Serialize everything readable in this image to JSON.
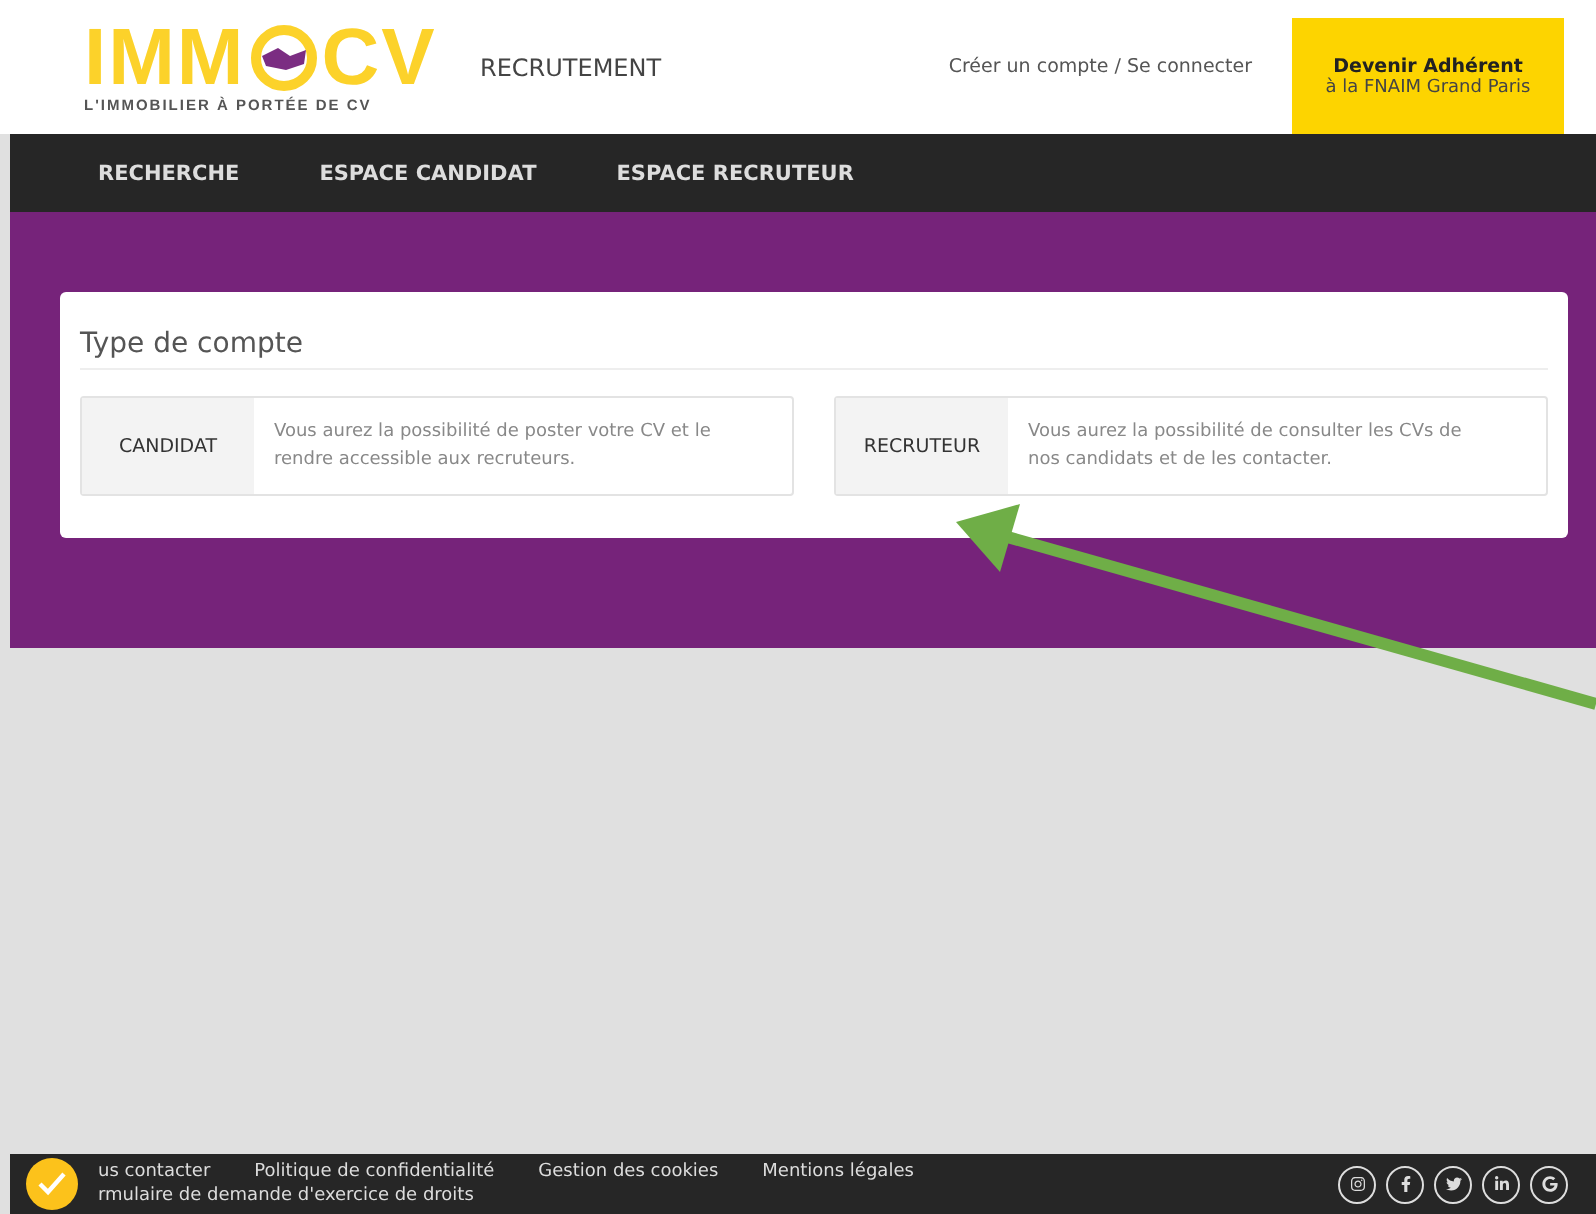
{
  "header": {
    "logo": {
      "left": "IMM",
      "right": "CV",
      "tagline": "L'IMMOBILIER À PORTÉE DE CV"
    },
    "section": "RECRUTEMENT",
    "account_link": "Créer un compte / Se connecter",
    "cta": {
      "title": "Devenir Adhérent",
      "subtitle": "à la FNAIM Grand Paris"
    }
  },
  "nav": [
    "RECHERCHE",
    "ESPACE CANDIDAT",
    "ESPACE RECRUTEUR"
  ],
  "panel": {
    "title": "Type de compte",
    "options": [
      {
        "label": "CANDIDAT",
        "description": "Vous aurez la possibilité de poster votre CV et le rendre accessible aux recruteurs."
      },
      {
        "label": "RECRUTEUR",
        "description": "Vous aurez la possibilité de consulter les CVs de nos candidats et de les contacter."
      }
    ]
  },
  "footer": {
    "links": [
      "us contacter",
      "Politique de confidentialité",
      "Gestion des cookies",
      "Mentions légales"
    ],
    "second_line": "rmulaire de demande d'exercice de droits",
    "social": [
      {
        "kind": "instagram"
      },
      {
        "kind": "facebook"
      },
      {
        "kind": "twitter"
      },
      {
        "kind": "linkedin"
      },
      {
        "kind": "google"
      }
    ]
  }
}
